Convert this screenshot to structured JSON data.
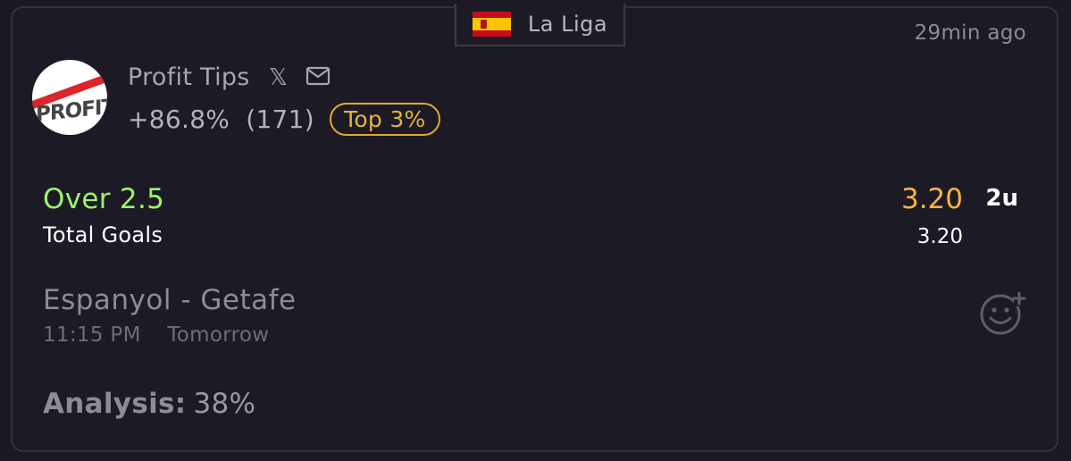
{
  "league": {
    "flag_icon": "spain-flag-icon",
    "name": "La Liga"
  },
  "time_ago": "29min ago",
  "tipster": {
    "avatar_text": "PROFIT",
    "name": "Profit Tips",
    "social_icons": [
      "x-icon",
      "mail-icon"
    ],
    "profit": "+86.8%",
    "count": "(171)",
    "rank_badge": "Top 3%"
  },
  "pick": {
    "selection": "Over 2.5",
    "market": "Total Goals",
    "odds": "3.20",
    "current_odds": "3.20",
    "stake": "2u"
  },
  "match": {
    "teams": "Espanyol - Getafe",
    "time": "11:15 PM",
    "day": "Tomorrow"
  },
  "analysis": {
    "label": "Analysis:",
    "value": "38%"
  },
  "colors": {
    "background": "#1b1a24",
    "selection": "#9ef36a",
    "odds": "#f5b541",
    "badge": "#e1a92e"
  }
}
